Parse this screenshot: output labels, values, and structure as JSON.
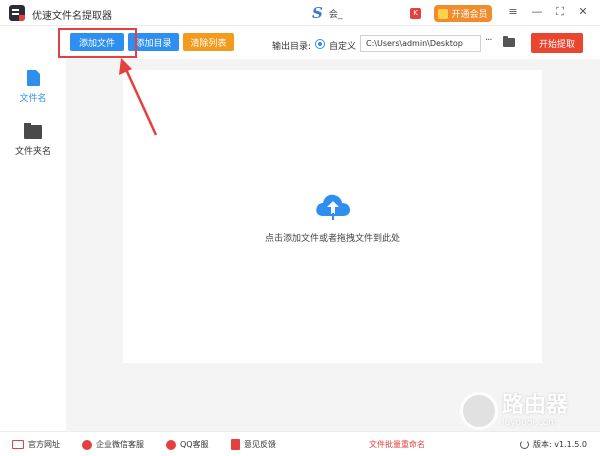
{
  "app": {
    "title": "优速文件名提取器"
  },
  "user": {
    "name": "会_",
    "badge": "K"
  },
  "vip_button": "开通会员",
  "window_controls": {
    "menu": "≡",
    "minimize": "—",
    "maximize": "⛶",
    "close": "✕"
  },
  "toolbar": {
    "add_file": "添加文件",
    "add_dir": "添加目录",
    "clear_list": "清除列表",
    "output_label": "输出目录:",
    "radio_label": "自定义",
    "output_path": "C:\\Users\\admin\\Desktop",
    "more": "···",
    "start": "开始提取"
  },
  "sidebar": {
    "items": [
      {
        "label": "文件名",
        "icon": "file-icon",
        "active": true
      },
      {
        "label": "文件夹名",
        "icon": "folder-icon",
        "active": false
      }
    ]
  },
  "main": {
    "drop_hint": "点击添加文件或者拖拽文件到此处"
  },
  "footer": {
    "items": [
      {
        "label": "官方网址",
        "icon": "website-icon"
      },
      {
        "label": "企业微信客服",
        "icon": "wechat-service-icon"
      },
      {
        "label": "QQ客服",
        "icon": "qq-icon"
      },
      {
        "label": "意见反馈",
        "icon": "feedback-icon"
      }
    ],
    "center": "文件批量重命名",
    "version": "版本: v1.1.5.0"
  },
  "watermark": {
    "main": "路由器",
    "sub": "luyouqi.com"
  },
  "colors": {
    "primary": "#2f8ff0",
    "orange": "#f29b1d",
    "red": "#e4403f",
    "start": "#e9452f"
  }
}
